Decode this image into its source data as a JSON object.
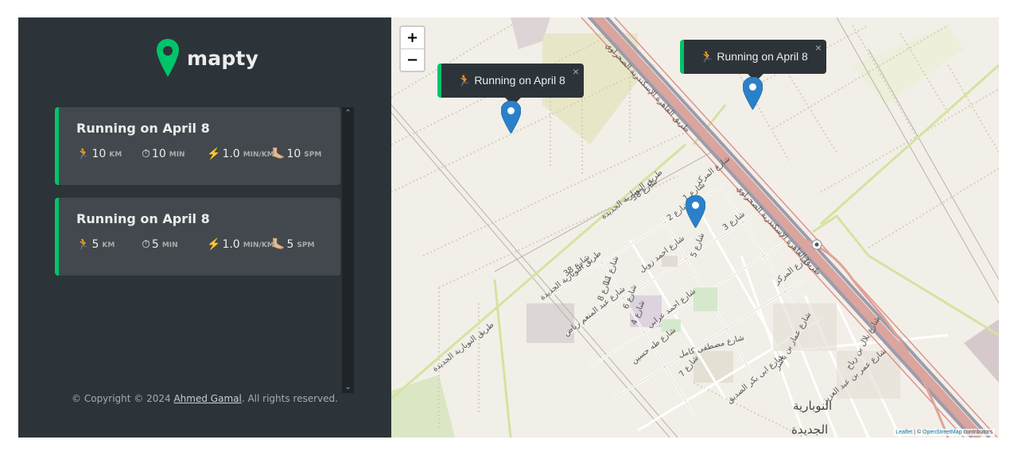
{
  "app": {
    "logo_text": "mapty"
  },
  "workouts": [
    {
      "title": "Running on April 8",
      "details": [
        {
          "icon": "🏃",
          "value": "10",
          "unit": "KM"
        },
        {
          "icon": "⏱",
          "value": "10",
          "unit": "MIN"
        },
        {
          "icon": "⚡️",
          "value": "1.0",
          "unit": "MIN/KM"
        },
        {
          "icon": "🦶🏼",
          "value": "10",
          "unit": "SPM"
        }
      ]
    },
    {
      "title": "Running on April 8",
      "details": [
        {
          "icon": "🏃",
          "value": "5",
          "unit": "KM"
        },
        {
          "icon": "⏱",
          "value": "5",
          "unit": "MIN"
        },
        {
          "icon": "⚡️",
          "value": "1.0",
          "unit": "MIN/KM"
        },
        {
          "icon": "🦶🏼",
          "value": "5",
          "unit": "SPM"
        }
      ]
    }
  ],
  "footer": {
    "prefix": "© Copyright © 2024 ",
    "author": "Ahmed Gamal",
    "suffix": ". All rights reserved."
  },
  "map": {
    "zoom_in": "+",
    "zoom_out": "−",
    "popups": [
      {
        "text": "🏃 Running on April 8",
        "close": "×"
      },
      {
        "text": "🏃 Running on April 8",
        "close": "×"
      }
    ],
    "attribution": {
      "leaflet": "Leaflet",
      "sep": " | © ",
      "osm": "OpenStreetMap",
      "suffix": " contributors"
    },
    "labels": {
      "highway": "طريق القاهرة الإسكندرية الصحراوي",
      "road_new1": "طريق النوبارية الجديدة",
      "road_new2": "طريق النوبارية الجديدة",
      "road_new3": "طريق النوبارية الجديدة",
      "st38": "شارع 38",
      "st38b": "شارع 38",
      "st1": "شارع 1",
      "st2": "شارع 2",
      "st3": "شارع 3",
      "st_markaz": "شارع المركز",
      "st_markaz2": "شارع المركز",
      "st_ahmed_zewail": "شارع احمد زويل",
      "st_ahmed_orabi": "شارع احمد عرابي",
      "st_mostafa_kamel": "شارع مصطفى كامل",
      "st_abdelmoneim": "شارع عبد المنعم رياض",
      "st_taha": "شارع طه حسين",
      "st_yasser": "شارع عمار بن ياسر",
      "st_abubakr": "شارع ابى بكر الصديق",
      "st_bilal": "شارع بلال بن رباح",
      "st_omar": "شارع عمر بن عبد العزيز",
      "st_11": "شارع 11",
      "st_8": "شارع 8",
      "st_6": "شارع 6",
      "st_4": "شارع 4",
      "st_7": "شارع 7",
      "st_5": "شارع 5",
      "city": "النوبارية",
      "city2": "الجديدة"
    }
  },
  "colors": {
    "sidebar_bg": "#2d3439",
    "card_bg": "#42484d",
    "running_accent": "#00c46a",
    "marker": "#2a81cb"
  }
}
